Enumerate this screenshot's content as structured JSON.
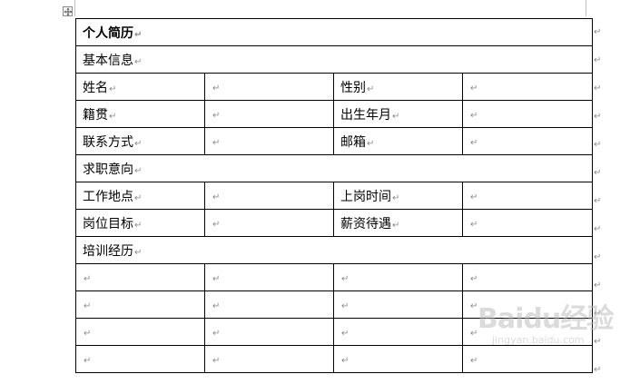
{
  "document": {
    "title": "个人简历",
    "paragraph_mark": "↵",
    "sections": {
      "basic_info": "基本信息",
      "job_intention": "求职意向",
      "training": "培训经历"
    },
    "fields": {
      "name": "姓名",
      "gender": "性别",
      "native_place": "籍贯",
      "birth_date": "出生年月",
      "contact": "联系方式",
      "email": "邮箱",
      "work_location": "工作地点",
      "start_time": "上岗时间",
      "position_goal": "岗位目标",
      "salary": "薪资待遇"
    }
  },
  "watermark": {
    "brand": "Baidu经验",
    "url": "jingyan.baidu.com"
  },
  "icons": {
    "table_move_handle": "table-move-icon"
  }
}
